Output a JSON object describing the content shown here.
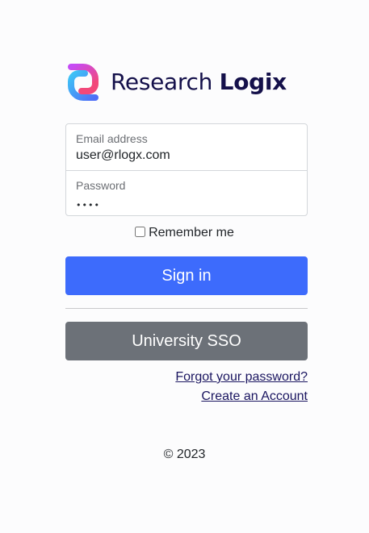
{
  "brand": {
    "name_light": "Research",
    "name_bold": "Logix",
    "logo_icon": "research-logix-logo-icon",
    "gradient_colors": [
      "#c54bf6",
      "#f2487a",
      "#4f6ef7",
      "#3ec5f6"
    ],
    "text_color": "#14104a"
  },
  "form": {
    "email": {
      "label": "Email address",
      "value": "user@rlogx.com"
    },
    "password": {
      "label": "Password",
      "value": "••••"
    },
    "remember_me": {
      "label": "Remember me",
      "checked": false
    },
    "sign_in_label": "Sign in",
    "sso_label": "University SSO"
  },
  "links": {
    "forgot_password": "Forgot your password?",
    "create_account": "Create an Account"
  },
  "footer": {
    "copyright": "© 2023"
  },
  "colors": {
    "primary": "#3d6bfc",
    "secondary": "#6c7178",
    "link": "#1a1560"
  }
}
